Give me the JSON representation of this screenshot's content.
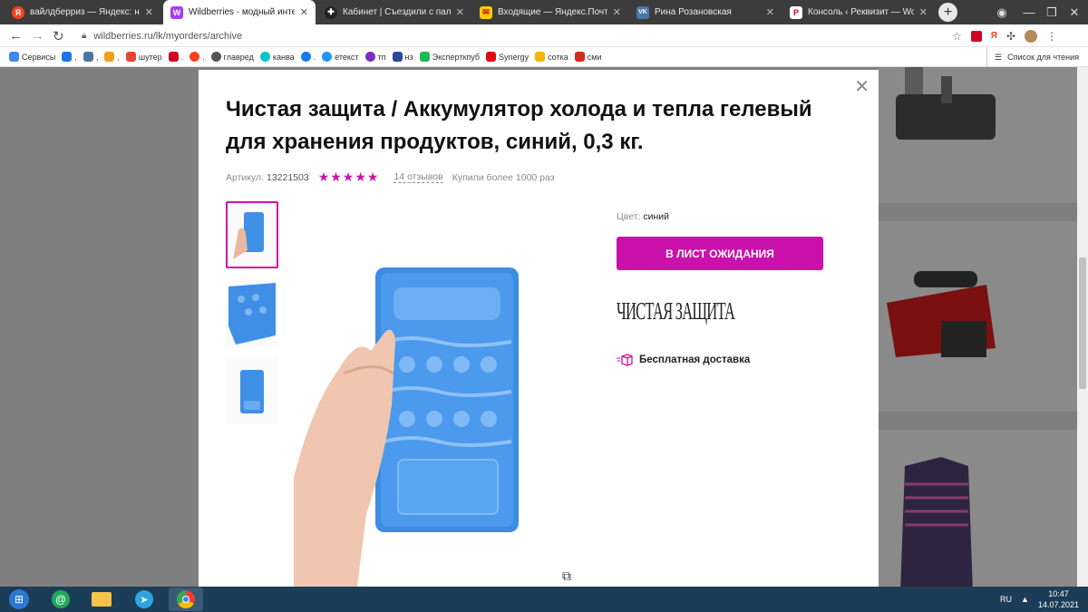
{
  "browser": {
    "tabs": [
      {
        "title": "вайлдберриз — Яндекс: наш",
        "favicon_text": "Я",
        "favicon_color": "#fc3f1d"
      },
      {
        "title": "Wildberries - модный интерне",
        "favicon_text": "W",
        "favicon_color": "#a73afd"
      },
      {
        "title": "Кабинет | Съездили с палатка",
        "favicon_text": "✚",
        "favicon_color": "#222222"
      },
      {
        "title": "Входящие — Яндекс.Почта",
        "favicon_text": "✉",
        "favicon_color": "#ffcc00"
      },
      {
        "title": "Рина Розановская",
        "favicon_text": "VK",
        "favicon_color": "#4a76a8"
      },
      {
        "title": "Консоль ‹ Реквизит — WordP",
        "favicon_text": "P",
        "favicon_color": "#d10024"
      }
    ],
    "active_tab_index": 1,
    "url": "wildberries.ru/lk/myorders/archive",
    "bookmarks": [
      {
        "label": "Сервисы",
        "color": "#4285f4"
      },
      {
        "label": ".",
        "color": "#1a73e8"
      },
      {
        "label": ",",
        "color": "#4a76a8"
      },
      {
        "label": ",",
        "color": "#f2a01c"
      },
      {
        "label": "шутер",
        "color": "#ea4335"
      },
      {
        "label": ".",
        "color": "#d10024"
      },
      {
        "label": ".",
        "color": "#fc3f1d"
      },
      {
        "label": "главред",
        "color": "#555555"
      },
      {
        "label": "канва",
        "color": "#00c4cc"
      },
      {
        "label": ".",
        "color": "#1877f2"
      },
      {
        "label": "етекст",
        "color": "#2196f3"
      },
      {
        "label": "тп",
        "color": "#7b2fbe"
      },
      {
        "label": "нз",
        "color": "#2b4a9b"
      },
      {
        "label": "Эксперткпуб",
        "color": "#1db954"
      },
      {
        "label": "Synergy",
        "color": "#e30613"
      },
      {
        "label": "сотка",
        "color": "#f5b400"
      },
      {
        "label": "сми",
        "color": "#d52b1e"
      }
    ],
    "reading_list": "Список для чтения"
  },
  "modal": {
    "title": "Чистая защита / Аккумулятор холода и тепла гелевый для хранения продуктов, синий, 0,3 кг.",
    "article_label": "Артикул:",
    "article_value": "13221503",
    "rating_stars": "★★★★★",
    "reviews": "14 отзывов",
    "bought": "Купили более 1000 раз",
    "color_label": "Цвет:",
    "color_value": "синий",
    "wait_button": "В ЛИСТ ОЖИДАНИЯ",
    "brand_logo": "ЧИСТАЯ ЗАЩИТА",
    "delivery": "Бесплатная доставка",
    "accent": "#cb11ab"
  },
  "taskbar": {
    "lang": "RU",
    "time": "10:47",
    "date": "14.07.2021"
  }
}
